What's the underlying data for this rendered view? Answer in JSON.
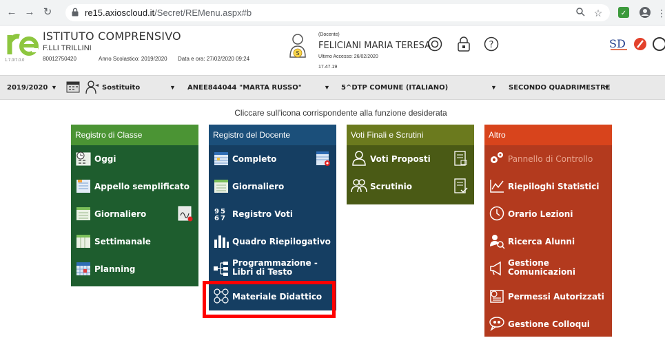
{
  "browser": {
    "url_host": "re15.axioscloud.it",
    "url_path": "/Secret/REMenu.aspx#b"
  },
  "header": {
    "school_name": "ISTITUTO COMPRENSIVO",
    "school_sub": "F.LLI TRILLINI",
    "school_code": "80012750420",
    "school_year": "Anno Scolastico: 2019/2020",
    "datetime": "Data e ora: 27/02/2020 09:24",
    "version": "1.7.0/7.0.0",
    "role": "(Docente)",
    "user_name": "FELICIANI MARIA TERESA",
    "last_access": "Ultimo Accesso: 26/02/2020",
    "last_time": "17.47.19",
    "user_badge": "S"
  },
  "toolbar": {
    "year": "2019/2020",
    "substitute": "Sostituito",
    "school_unit": "ANEE844044 \"MARTA RUSSO\"",
    "class": "5^DTP COMUNE (ITALIANO)",
    "period": "SECONDO QUADRIMESTRE"
  },
  "instruction": "Cliccare sull'icona corrispondente alla funzione desiderata",
  "panels": {
    "registro_classe": {
      "title": "Registro di Classe",
      "items": [
        "Oggi",
        "Appello semplificato",
        "Giornaliero",
        "Settimanale",
        "Planning"
      ]
    },
    "registro_docente": {
      "title": "Registro del Docente",
      "items": [
        "Completo",
        "Giornaliero",
        "Registro Voti",
        "Quadro Riepilogativo",
        "Programmazione -",
        "Libri di Testo",
        "Materiale Didattico"
      ]
    },
    "voti_finali": {
      "title": "Voti Finali e Scrutini",
      "items": [
        "Voti Proposti",
        "Scrutinio"
      ]
    },
    "altro": {
      "title": "Altro",
      "items": [
        "Pannello di Controllo",
        "Riepiloghi Statistici",
        "Orario Lezioni",
        "Ricerca Alunni",
        "Gestione",
        "Comunicazioni",
        "Permessi Autorizzati",
        "Gestione Colloqui"
      ]
    }
  },
  "colors": {
    "green_head": "#4b9434",
    "green_body": "#1e5d2e",
    "blue_head": "#1b4f7a",
    "blue_body": "#153e62",
    "olive_head": "#6b7a1e",
    "olive_body": "#4a5a15",
    "orange_head": "#d8441c",
    "orange_body": "#b33a1e",
    "highlight": "#ff0000"
  }
}
